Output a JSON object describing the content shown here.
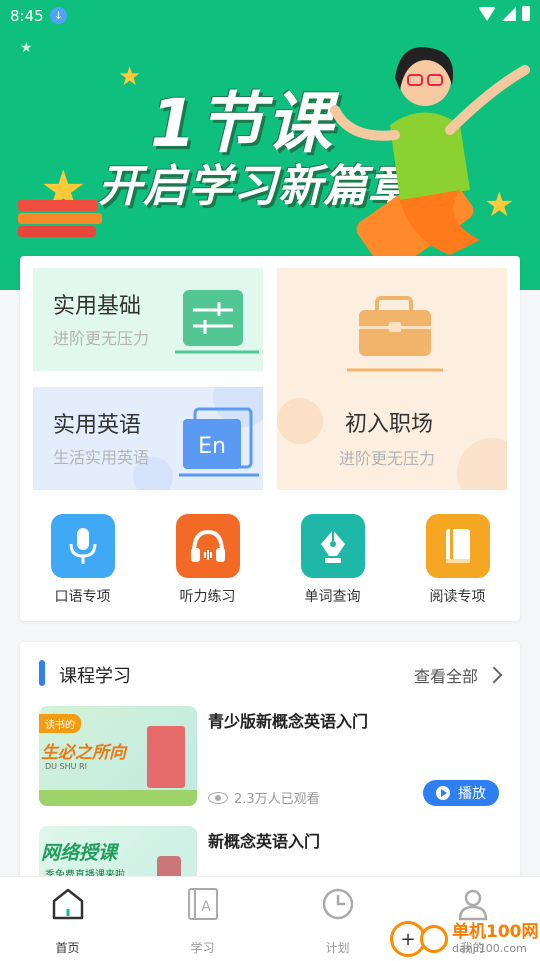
{
  "status": {
    "time": "8:45"
  },
  "banner": {
    "line1": "1节课",
    "line2": "开启学习新篇章"
  },
  "categories": [
    {
      "title": "实用基础",
      "subtitle": "进阶更无压力"
    },
    {
      "title": "实用英语",
      "subtitle": "生活实用英语",
      "icon_text": "En"
    },
    {
      "title": "初入职场",
      "subtitle": "进阶更无压力"
    }
  ],
  "quick_links": [
    {
      "label": "口语专项",
      "icon": "microphone-icon",
      "color": "#3fa9f5"
    },
    {
      "label": "听力练习",
      "icon": "headphones-icon",
      "color": "#f26a26"
    },
    {
      "label": "单词查询",
      "icon": "pen-nib-icon",
      "color": "#1fb8a8"
    },
    {
      "label": "阅读专项",
      "icon": "book-icon",
      "color": "#f5a623"
    }
  ],
  "course_section": {
    "title": "课程学习",
    "view_all": "查看全部",
    "courses": [
      {
        "name": "青少版新概念英语入门",
        "views": "2.3万人已观看",
        "play_label": "播放",
        "thumb_title": "生必之所向",
        "thumb_tag": "读书的",
        "thumb_sub": "DU SHU RI"
      },
      {
        "name": "新概念英语入门",
        "thumb_title": "网络授课",
        "thumb_sub": "季免费直播课来啦"
      }
    ]
  },
  "bottom_nav": [
    {
      "label": "首页",
      "icon": "home-icon",
      "active": true
    },
    {
      "label": "学习",
      "icon": "study-icon",
      "active": false
    },
    {
      "label": "计划",
      "icon": "clock-icon",
      "active": false
    },
    {
      "label": "我的",
      "icon": "profile-icon",
      "active": false
    }
  ],
  "watermark": {
    "name": "单机100网",
    "url": "danji100.com"
  },
  "colors": {
    "brand_green": "#0fbf7d",
    "accent_blue": "#2e7ff2"
  }
}
